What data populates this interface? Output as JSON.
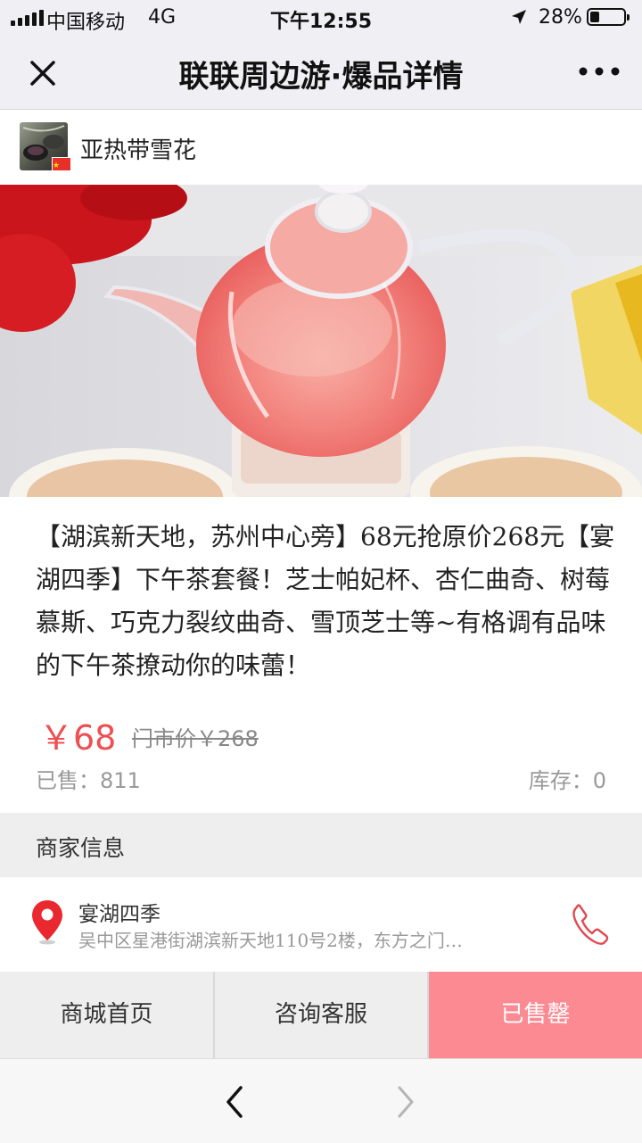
{
  "status_bar": {
    "carrier": "中国移动",
    "network": "4G",
    "time": "下午12:55",
    "battery_percent": "28%",
    "battery_level": 0.28
  },
  "navbar": {
    "title": "联联周边游·爆品详情",
    "close_icon": "close-icon",
    "more_icon": "more-dots-icon"
  },
  "shop": {
    "name": "亚热带雪花"
  },
  "carousel": {
    "slide_count": 6,
    "active_index": 3
  },
  "product": {
    "title": "【湖滨新天地，苏州中心旁】68元抢原价268元【宴湖四季】下午茶套餐！芝士帕妃杯、杏仁曲奇、树莓慕斯、巧克力裂纹曲奇、雪顶芝士等~有格调有品味的下午茶撩动你的味蕾！",
    "price": "￥68",
    "original_price": "门市价￥268",
    "sold": "已售：811",
    "stock": "库存：0"
  },
  "merchant_section": {
    "label": "商家信息",
    "name": "宴湖四季",
    "address": "吴中区星港街湖滨新天地110号2楼，东方之门…",
    "pin_icon": "location-pin-icon",
    "phone_icon": "phone-icon"
  },
  "bottom_bar": {
    "home": "商城首页",
    "service": "咨询客服",
    "sold_out": "已售罄"
  },
  "colors": {
    "accent": "#ee4f52",
    "sold_out_bg": "#fc8a92"
  }
}
